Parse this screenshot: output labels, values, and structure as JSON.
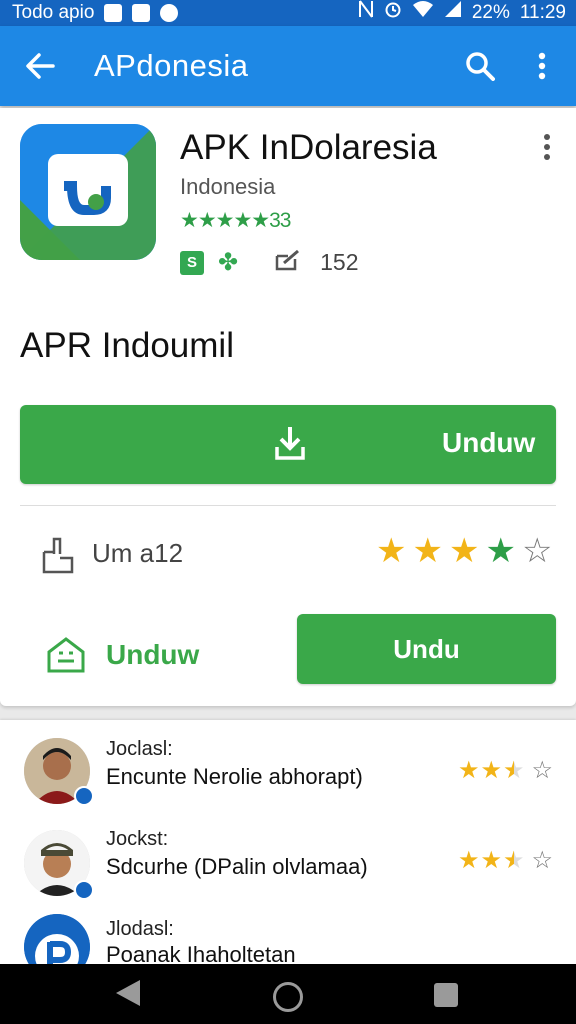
{
  "status_bar": {
    "left_text": "Todo apio",
    "battery": "22%",
    "time": "11:29"
  },
  "app_bar": {
    "title": "APdonesia"
  },
  "app": {
    "name": "APK InDolaresia",
    "developer": "Indonesia",
    "rating_text": "★★★★★33",
    "review_count": "152",
    "subtitle": "APR Indoumil"
  },
  "main_button": {
    "label": "Unduw"
  },
  "share_row": {
    "label": "Um a12",
    "rating_stars": 4,
    "max_stars": 5
  },
  "secondary": {
    "link_label": "Unduw",
    "button_label": "Undu"
  },
  "reviews": [
    {
      "label": "Joclаsl:",
      "text": "Encunte Nerolie abhorapt)",
      "rating_stars": 2.5,
      "max_stars": 3
    },
    {
      "label": "Jockst:",
      "text": "Sdcurhe (DPalin olvlamaa)",
      "rating_stars": 2.5,
      "max_stars": 3
    },
    {
      "label": "Jlodasl:",
      "text": "Poanak Ihaholtetan",
      "rating_stars": 0,
      "max_stars": 0
    }
  ],
  "colors": {
    "status_bar": "#1565c0",
    "app_bar": "#1e88e5",
    "accent_green": "#3aa849",
    "star_gold": "#f2b418",
    "star_green": "#2e9e48"
  }
}
